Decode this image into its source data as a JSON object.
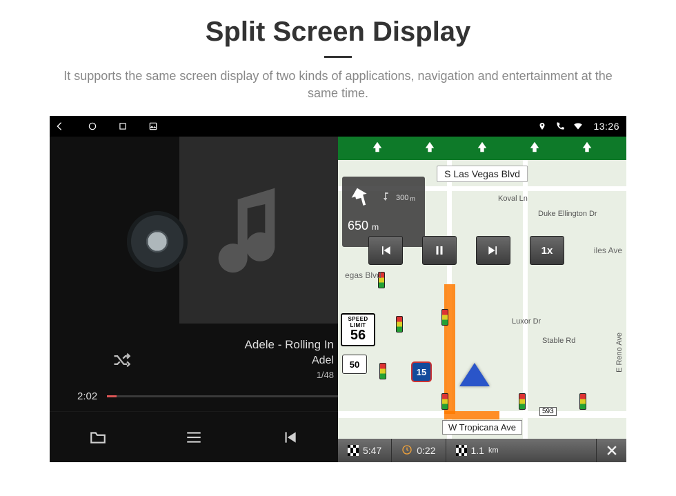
{
  "header": {
    "title": "Split Screen Display",
    "subtitle": "It supports the same screen display of two kinds of applications, navigation and entertainment at the same time."
  },
  "statusbar": {
    "time": "13:26"
  },
  "music": {
    "now_playing_line1": "Adele - Rolling In",
    "now_playing_line2": "Adel",
    "track_index": "1/48",
    "elapsed": "2:02"
  },
  "nav": {
    "road_top": "S Las Vegas Blvd",
    "turn": {
      "next_distance": "300",
      "next_unit": "m",
      "remaining": "650",
      "remaining_unit": "m"
    },
    "controls": {
      "speed_multiplier": "1x"
    },
    "speed_limit": {
      "label_top": "SPEED",
      "label_bottom": "LIMIT",
      "value": "56"
    },
    "route_shield": "50",
    "interstate": "15",
    "streets": {
      "koval": "Koval Ln",
      "duke": "Duke Ellington Dr",
      "luxor": "Luxor Dr",
      "stable": "Stable Rd",
      "reno": "E Reno Ave",
      "vegas_suffix": "egas Blvd",
      "iles": "iles Ave"
    },
    "exit_badge": "593",
    "bottom_road": "W Tropicana Ave",
    "footer": {
      "eta": "5:47",
      "duration": "0:22",
      "distance": "1.1",
      "distance_unit": "km"
    }
  }
}
